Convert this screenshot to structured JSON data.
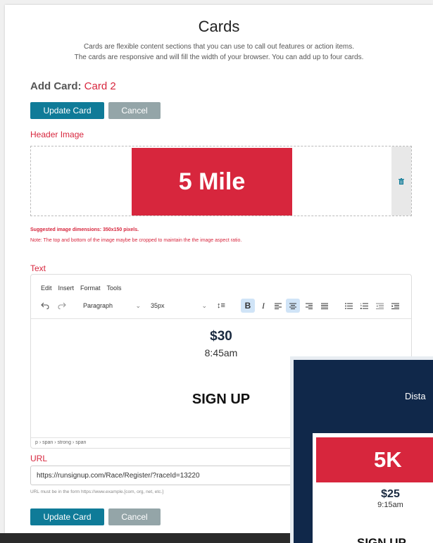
{
  "header": {
    "title": "Cards",
    "subtitle_line1": "Cards are flexible content sections that you can use to call out features or action items.",
    "subtitle_line2": "The cards are responsive and will fill the width of your browser. You can add up to four cards."
  },
  "form": {
    "add_card_label": "Add Card:",
    "card_name": "Card 2",
    "update_label": "Update Card",
    "cancel_label": "Cancel",
    "header_image_label": "Header Image",
    "header_image_text": "5 Mile",
    "image_dims_hint": "Suggested image dimensions: 350x150 pixels.",
    "image_crop_note": "Note: The top and bottom of the image maybe be cropped to maintain the the image aspect ratio.",
    "text_label": "Text",
    "url_label": "URL",
    "url_value": "https://runsignup.com/Race/Register/?raceId=13220",
    "url_hint": "URL must be in the form https://www.example.[com, org, net, etc.]"
  },
  "editor": {
    "menus": [
      "Edit",
      "Insert",
      "Format",
      "Tools"
    ],
    "block_format": "Paragraph",
    "font_size": "35px",
    "content_price": "$30",
    "content_time": "8:45am",
    "content_signup": "SIGN UP",
    "path": "p › span › strong › span"
  },
  "preview": {
    "title": "Dista",
    "card_banner": "5K",
    "card_price": "$25",
    "card_time": "9:15am",
    "card_signup": "SIGN UP"
  },
  "colors": {
    "accent_red": "#d7263d",
    "primary_blue": "#0f7b98",
    "navy": "#10284a"
  }
}
